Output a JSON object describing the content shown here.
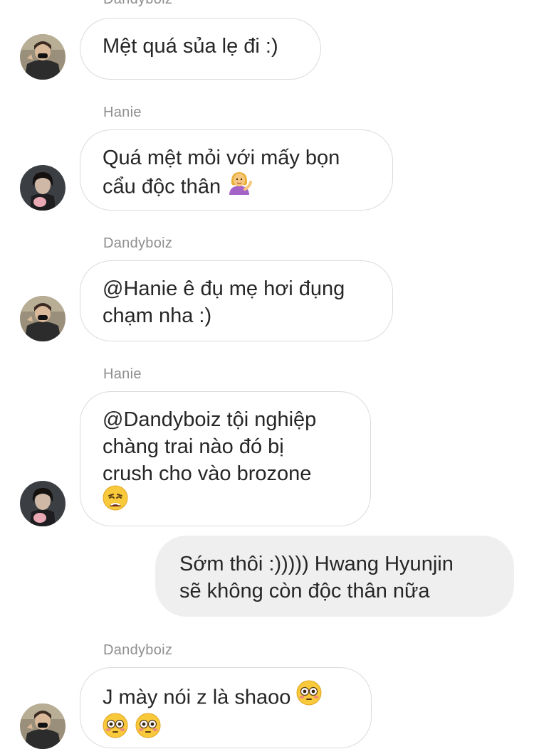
{
  "messages": [
    {
      "sender": "Dandyboiz",
      "direction": "incoming",
      "lines": [
        "Mệt quá sủa lẹ đi :)"
      ]
    },
    {
      "sender": "Hanie",
      "direction": "incoming",
      "lines": [
        "Quá mệt mỏi với mấy bọn",
        "cẩu độc thân "
      ],
      "emoji": "woman-tipping-hand"
    },
    {
      "sender": "Dandyboiz",
      "direction": "incoming",
      "lines": [
        "@Hanie ê đụ mẹ hơi đụng",
        "chạm nha :)"
      ]
    },
    {
      "sender": "Hanie",
      "direction": "incoming",
      "lines": [
        "@Dandyboiz tội nghiệp",
        "chàng trai nào đó bị",
        "crush cho vào brozone"
      ],
      "emoji": "weary-face"
    },
    {
      "direction": "outgoing",
      "lines": [
        "Sớm thôi :))))) Hwang Hyunjin",
        "sẽ không còn độc thân nữa"
      ]
    },
    {
      "sender": "Dandyboiz",
      "direction": "incoming",
      "lines": [
        "J mày nói z là shaoo "
      ],
      "emoji": "flushed-face"
    }
  ],
  "colors": {
    "sender_label": "#8e8e8e",
    "incoming_border": "#dbdbdb",
    "outgoing_bg": "#efefef",
    "text": "#262626"
  }
}
